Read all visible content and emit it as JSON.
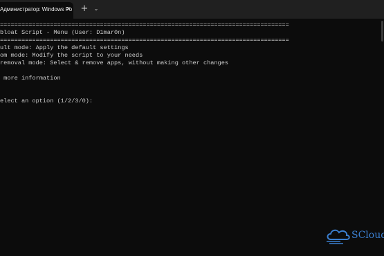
{
  "tab": {
    "title": "Администратор: Windows Po",
    "close_glyph": "✕",
    "new_tab_glyph": "+",
    "dropdown_glyph": "⌄"
  },
  "console": {
    "lines": [
      "=================================================================================",
      "bloat Script - Menu (User: D1mar0n)",
      "=================================================================================",
      "ult mode: Apply the default settings",
      "om mode: Modify the script to your needs",
      "removal mode: Select & remove apps, without making other changes",
      "",
      " more information",
      "",
      "",
      "elect an option (1/2/3/0):"
    ]
  },
  "watermark": {
    "text": "SCloud",
    "icon": "cloud-logo-icon",
    "color": "#3b7fd0"
  }
}
